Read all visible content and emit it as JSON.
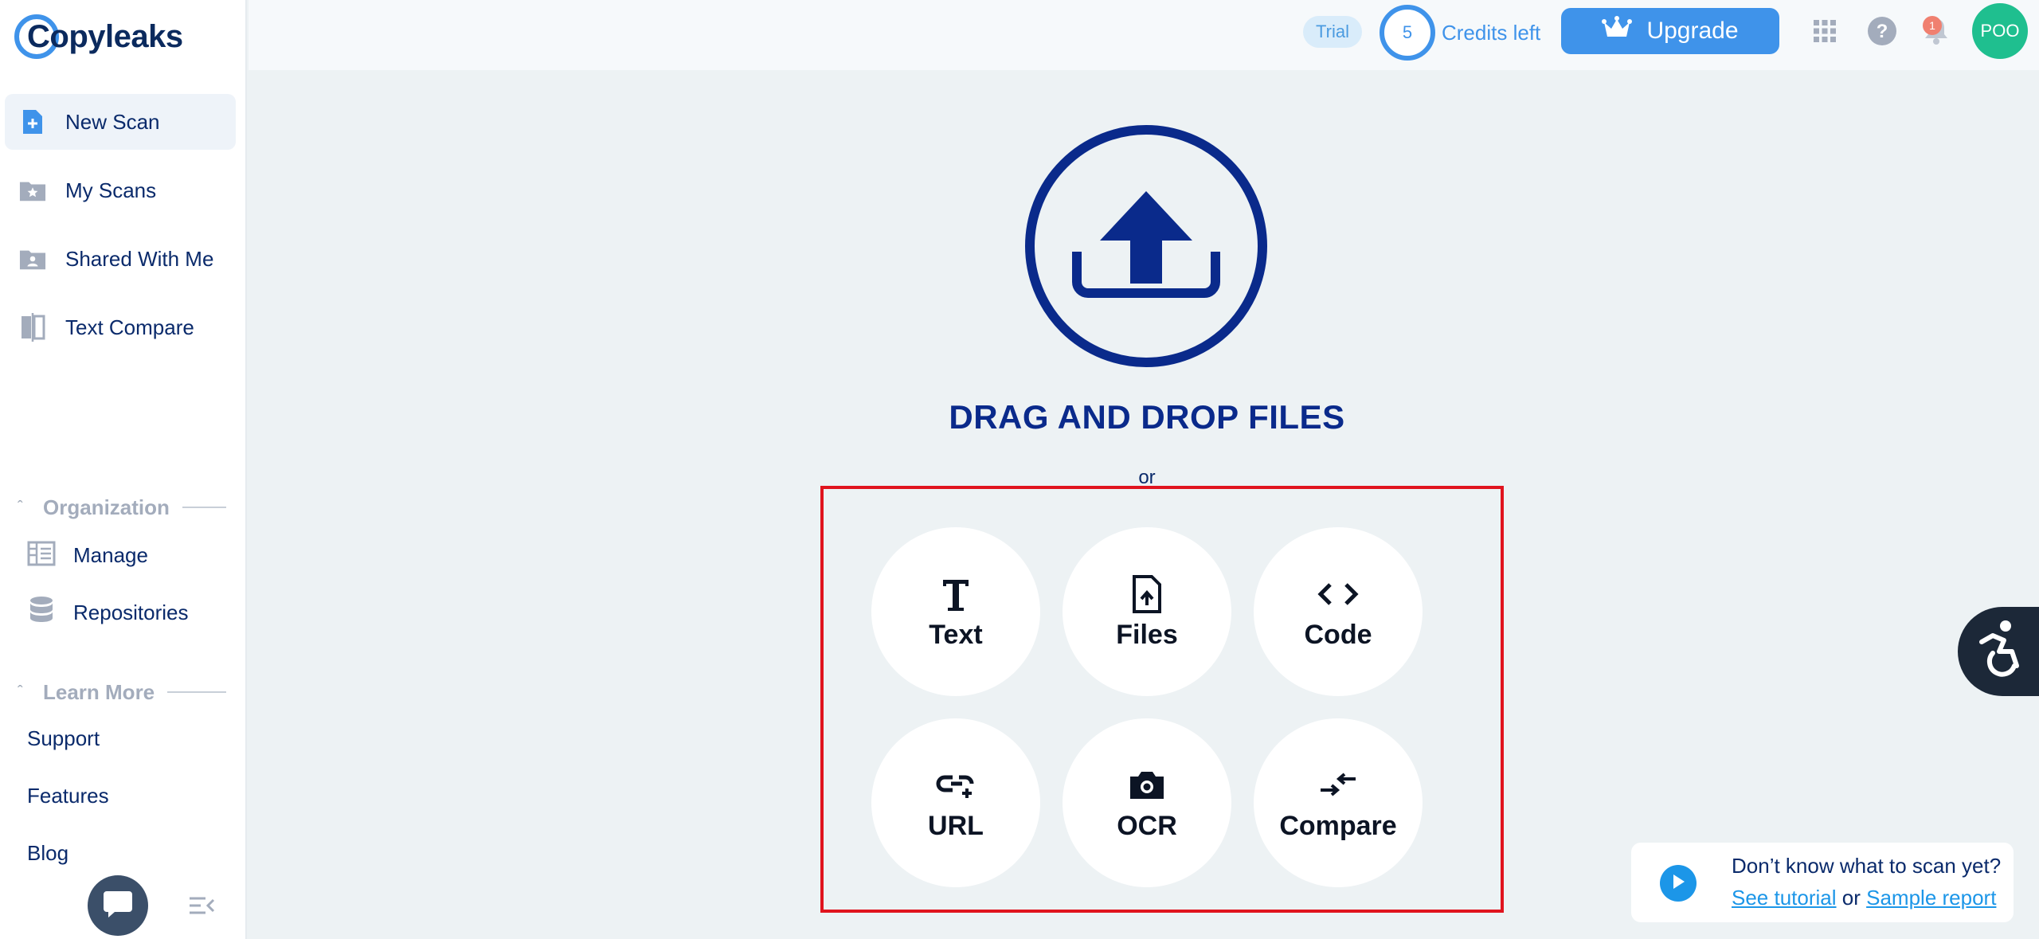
{
  "app": {
    "logo_text": "Copyleaks"
  },
  "sidebar": {
    "items": [
      {
        "label": "New Scan",
        "icon": "new-scan-icon"
      },
      {
        "label": "My Scans",
        "icon": "folder-star-icon"
      },
      {
        "label": "Shared With Me",
        "icon": "folder-user-icon"
      },
      {
        "label": "Text Compare",
        "icon": "compare-doc-icon"
      }
    ],
    "organization": {
      "title": "Organization",
      "items": [
        {
          "label": "Manage",
          "icon": "manage-icon"
        },
        {
          "label": "Repositories",
          "icon": "database-icon"
        }
      ]
    },
    "learn_more": {
      "title": "Learn More",
      "links": [
        "Support",
        "Features",
        "Blog"
      ]
    }
  },
  "topbar": {
    "trial_label": "Trial",
    "credits_count": "5",
    "credits_label": "Credits left",
    "upgrade_label": "Upgrade",
    "notification_count": "1",
    "avatar_initials": "POO"
  },
  "main": {
    "drag_title": "DRAG AND DROP FILES",
    "or_text": "or",
    "options": [
      {
        "label": "Text",
        "icon": "text-icon"
      },
      {
        "label": "Files",
        "icon": "file-upload-icon"
      },
      {
        "label": "Code",
        "icon": "code-icon"
      },
      {
        "label": "URL",
        "icon": "link-icon"
      },
      {
        "label": "OCR",
        "icon": "camera-icon"
      },
      {
        "label": "Compare",
        "icon": "compare-arrows-icon"
      }
    ]
  },
  "help": {
    "question": "Don’t know what to scan yet?",
    "tutorial_link": "See tutorial",
    "or_word": "or",
    "sample_link": "Sample report"
  },
  "colors": {
    "accent": "#3f93ea",
    "brand_dark": "#0a2a8b",
    "highlight_frame": "#e0141e",
    "avatar": "#1fbf8f"
  }
}
